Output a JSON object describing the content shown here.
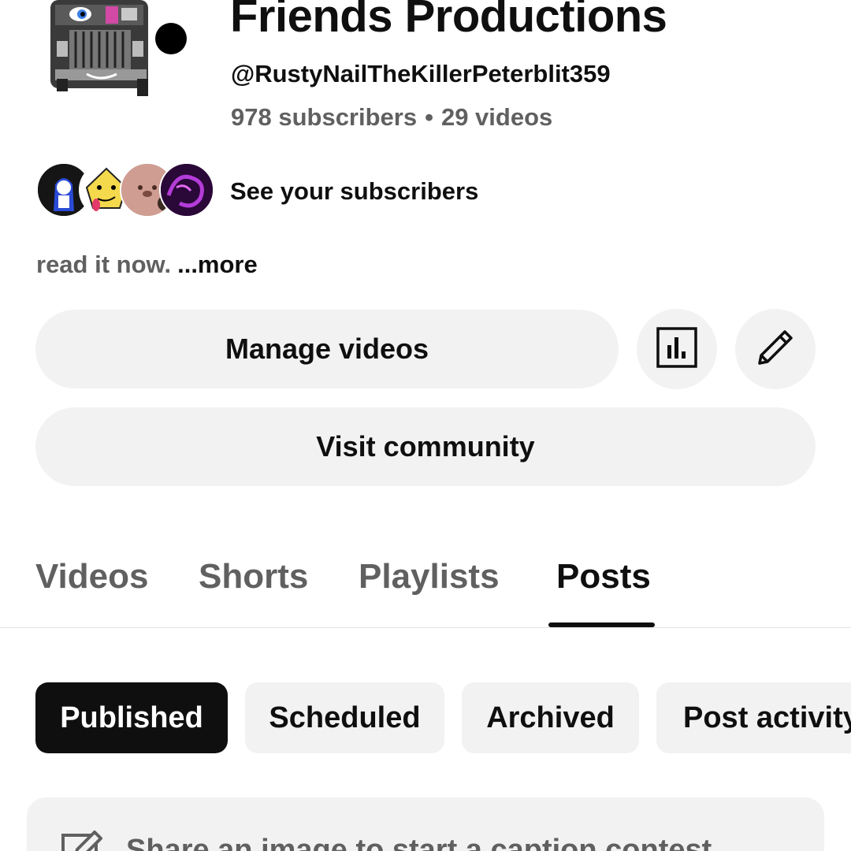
{
  "channel": {
    "title": "Friends Productions",
    "handle": "@RustyNailTheKillerPeterblit359",
    "subscribers": "978 subscribers",
    "separator": "•",
    "videos": "29 videos"
  },
  "subscribers_row": {
    "label": "See your subscribers"
  },
  "description": {
    "text": "read it now.",
    "more": "...more"
  },
  "actions": {
    "manage_videos": "Manage videos",
    "analytics_icon": "analytics-icon",
    "edit_icon": "pencil-icon",
    "visit_community": "Visit community"
  },
  "tabs": [
    {
      "label": "Videos",
      "active": false
    },
    {
      "label": "Shorts",
      "active": false
    },
    {
      "label": "Playlists",
      "active": false
    },
    {
      "label": "Posts",
      "active": true
    }
  ],
  "chips": [
    {
      "label": "Published",
      "selected": true
    },
    {
      "label": "Scheduled",
      "selected": false
    },
    {
      "label": "Archived",
      "selected": false
    },
    {
      "label": "Post activity",
      "selected": false
    }
  ],
  "composer": {
    "icon": "edit-square-icon",
    "placeholder": "Share an image to start a caption contest"
  },
  "colors": {
    "text_primary": "#0f0f0f",
    "text_secondary": "#606060",
    "chip_bg": "#f2f2f2",
    "chip_selected_bg": "#0f0f0f"
  }
}
